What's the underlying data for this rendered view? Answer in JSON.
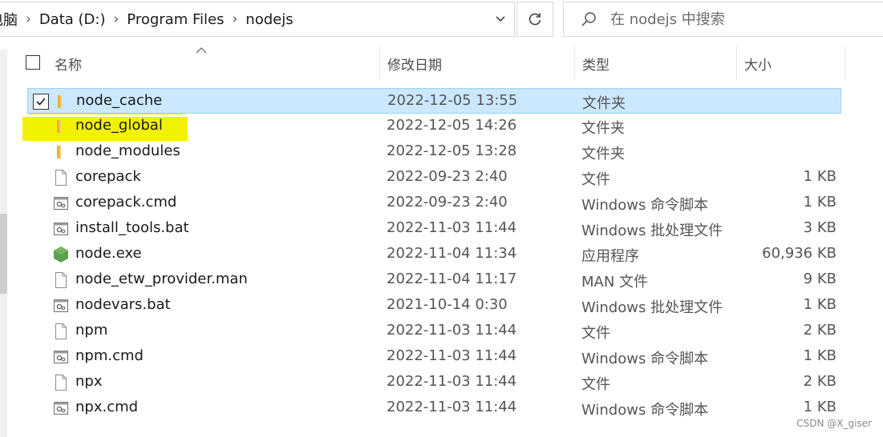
{
  "address": {
    "crumbs": [
      "电脑",
      "Data (D:)",
      "Program Files",
      "nodejs"
    ]
  },
  "search": {
    "placeholder": "在 nodejs 中搜索"
  },
  "columns": {
    "name": "名称",
    "date": "修改日期",
    "type": "类型",
    "size": "大小"
  },
  "files": [
    {
      "name": "node_cache",
      "date": "2022-12-05 13:55",
      "type": "文件夹",
      "size": "",
      "icon": "folder-icon",
      "selected": true,
      "highlight": "yellow"
    },
    {
      "name": "node_global",
      "date": "2022-12-05 14:26",
      "type": "文件夹",
      "size": "",
      "icon": "folder-icon",
      "selected": false,
      "highlight": "yellow"
    },
    {
      "name": "node_modules",
      "date": "2022-12-05 13:28",
      "type": "文件夹",
      "size": "",
      "icon": "folder-icon",
      "selected": false
    },
    {
      "name": "corepack",
      "date": "2022-09-23 2:40",
      "type": "文件",
      "size": "1 KB",
      "icon": "file-icon",
      "selected": false
    },
    {
      "name": "corepack.cmd",
      "date": "2022-09-23 2:40",
      "type": "Windows 命令脚本",
      "size": "1 KB",
      "icon": "script-icon",
      "selected": false
    },
    {
      "name": "install_tools.bat",
      "date": "2022-11-03 11:44",
      "type": "Windows 批处理文件",
      "size": "3 KB",
      "icon": "script-icon",
      "selected": false
    },
    {
      "name": "node.exe",
      "date": "2022-11-04 11:34",
      "type": "应用程序",
      "size": "60,936 KB",
      "icon": "nodejs-icon",
      "selected": false
    },
    {
      "name": "node_etw_provider.man",
      "date": "2022-11-04 11:17",
      "type": "MAN 文件",
      "size": "9 KB",
      "icon": "file-icon",
      "selected": false
    },
    {
      "name": "nodevars.bat",
      "date": "2021-10-14 0:30",
      "type": "Windows 批处理文件",
      "size": "1 KB",
      "icon": "script-icon",
      "selected": false
    },
    {
      "name": "npm",
      "date": "2022-11-03 11:44",
      "type": "文件",
      "size": "2 KB",
      "icon": "file-icon",
      "selected": false
    },
    {
      "name": "npm.cmd",
      "date": "2022-11-03 11:44",
      "type": "Windows 命令脚本",
      "size": "1 KB",
      "icon": "script-icon",
      "selected": false
    },
    {
      "name": "npx",
      "date": "2022-11-03 11:44",
      "type": "文件",
      "size": "2 KB",
      "icon": "file-icon",
      "selected": false
    },
    {
      "name": "npx.cmd",
      "date": "2022-11-03 11:44",
      "type": "Windows 命令脚本",
      "size": "1 KB",
      "icon": "script-icon",
      "selected": false
    }
  ],
  "watermark": "CSDN @X_giser",
  "colors": {
    "selection_bg": "#cce8ff",
    "selection_border": "#99d1ff",
    "folder": "#f7c95a",
    "nodejs": "#5fa04e",
    "highlight": "#f2f200"
  }
}
